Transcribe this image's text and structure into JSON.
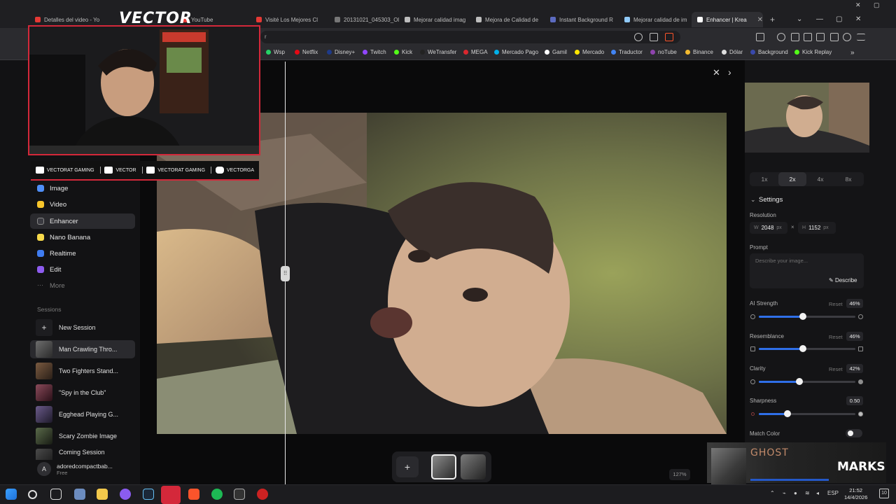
{
  "browser": {
    "tabs": [
      {
        "label": "Detalles del video - Yo",
        "favicon_color": "#e53935"
      },
      {
        "label": "YouTube",
        "favicon_color": "#e53935"
      },
      {
        "label": "Visité Los Mejores Cl",
        "favicon_color": "#e53935"
      },
      {
        "label": "20131021_045303_Ol",
        "favicon_color": "#777777"
      },
      {
        "label": "Mejorar calidad imag",
        "favicon_color": "#bdbdbd"
      },
      {
        "label": "Mejora de Calidad de",
        "favicon_color": "#bdbdbd"
      },
      {
        "label": "Instant Background R",
        "favicon_color": "#5c6bc0"
      },
      {
        "label": "Mejorar calidad de im",
        "favicon_color": "#90caf9"
      },
      {
        "label": "Enhancer | Krea",
        "favicon_color": "#ffffff"
      }
    ],
    "address_text": "r",
    "new_tab": "+",
    "bookmarks": [
      {
        "label": "Wsp",
        "color": "#25d366"
      },
      {
        "label": "Netflix",
        "color": "#e50914"
      },
      {
        "label": "Disney+",
        "color": "#1e3a8a"
      },
      {
        "label": "Twitch",
        "color": "#9146ff"
      },
      {
        "label": "Kick",
        "color": "#53fc18"
      },
      {
        "label": "WeTransfer",
        "color": "#222222"
      },
      {
        "label": "MEGA",
        "color": "#d9272e"
      },
      {
        "label": "Mercado Pago",
        "color": "#00b1ea"
      },
      {
        "label": "Gamil",
        "color": "#ffffff"
      },
      {
        "label": "Mercado",
        "color": "#ffe600"
      },
      {
        "label": "Traductor",
        "color": "#4285f4"
      },
      {
        "label": "noTube",
        "color": "#8e44ad"
      },
      {
        "label": "Binance",
        "color": "#f3ba2f"
      },
      {
        "label": "Dólar",
        "color": "#dddddd"
      },
      {
        "label": "Background",
        "color": "#3949ab"
      },
      {
        "label": "Kick Replay",
        "color": "#53fc18"
      }
    ]
  },
  "sidebar": {
    "nav": [
      {
        "label": "Image",
        "color": "#4f8ef7"
      },
      {
        "label": "Video",
        "color": "#f7c52b"
      },
      {
        "label": "Enhancer",
        "color": "#2e2e33"
      },
      {
        "label": "Nano Banana",
        "color": "#f7d94a"
      },
      {
        "label": "Realtime",
        "color": "#3f7cf0"
      },
      {
        "label": "Edit",
        "color": "#8e5cf0"
      },
      {
        "label": "More",
        "color": "#444444"
      }
    ],
    "sessions_header": "Sessions",
    "new_session": "New Session",
    "sessions": [
      "Man Crawling Thro...",
      "Two Fighters Stand...",
      "\"Spy in the Club\"",
      "Egghead Playing G...",
      "Scary Zombie Image",
      "Coming Session"
    ],
    "user": {
      "initial": "A",
      "name": "adoredcompactbab...",
      "plan": "Free"
    }
  },
  "canvas": {
    "zoom": "127%",
    "add": "+",
    "close": "✕",
    "next": "›"
  },
  "panel": {
    "scales": [
      "1x",
      "2x",
      "4x",
      "8x"
    ],
    "active_scale": "2x",
    "settings_title": "Settings",
    "resolution_label": "Resolution",
    "width_key": "W",
    "height_key": "H",
    "width": "2048",
    "height": "1152",
    "unit": "px",
    "times": "×",
    "prompt_label": "Prompt",
    "prompt_placeholder": "Describe your image...",
    "describe": "Describe",
    "reset": "Reset",
    "sliders": [
      {
        "label": "AI Strength",
        "value": "46%",
        "level": 0.46
      },
      {
        "label": "Resemblance",
        "value": "46%",
        "level": 0.46
      },
      {
        "label": "Clarity",
        "value": "42%",
        "level": 0.42
      },
      {
        "label": "Sharpness",
        "value": "0.50",
        "level": 0.3
      }
    ],
    "match_color": "Match Color"
  },
  "overlay": {
    "cam_title": "VECTOR",
    "socials": [
      {
        "label": "VECTORAT GAMING"
      },
      {
        "label": "VECTOR"
      },
      {
        "label": "VECTORAT GAMING"
      },
      {
        "label": "VECTORGA"
      }
    ],
    "ghost": "GHOST",
    "marks": "MARKS"
  },
  "taskbar": {
    "lang": "ESP",
    "time": "21:52",
    "date": "14/4/2026",
    "notifications": "10"
  }
}
